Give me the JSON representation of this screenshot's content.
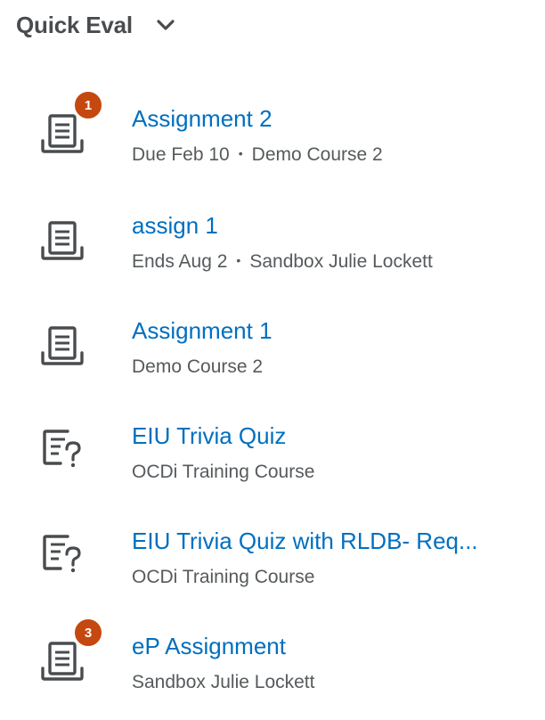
{
  "header": {
    "title": "Quick Eval",
    "toggle_icon": "chevron-down-icon"
  },
  "items": [
    {
      "title": "Assignment 2",
      "due": "Due Feb 10",
      "separator": "•",
      "course": "Demo Course 2",
      "icon": "assignment-icon",
      "badge": "1"
    },
    {
      "title": "assign 1",
      "due": "Ends Aug 2",
      "separator": "•",
      "course": "Sandbox Julie Lockett",
      "icon": "assignment-icon"
    },
    {
      "title": "Assignment 1",
      "course": "Demo Course 2",
      "icon": "assignment-icon"
    },
    {
      "title": "EIU Trivia Quiz",
      "course": "OCDi Training Course",
      "icon": "quiz-icon"
    },
    {
      "title": "EIU Trivia Quiz with RLDB- Req...",
      "course": "OCDi Training Course",
      "icon": "quiz-icon"
    },
    {
      "title": "eP Assignment",
      "course": "Sandbox Julie Lockett",
      "icon": "assignment-icon",
      "badge": "3"
    }
  ],
  "colors": {
    "link": "#006fbf",
    "text": "#494c4e",
    "badge": "#c4480f"
  }
}
